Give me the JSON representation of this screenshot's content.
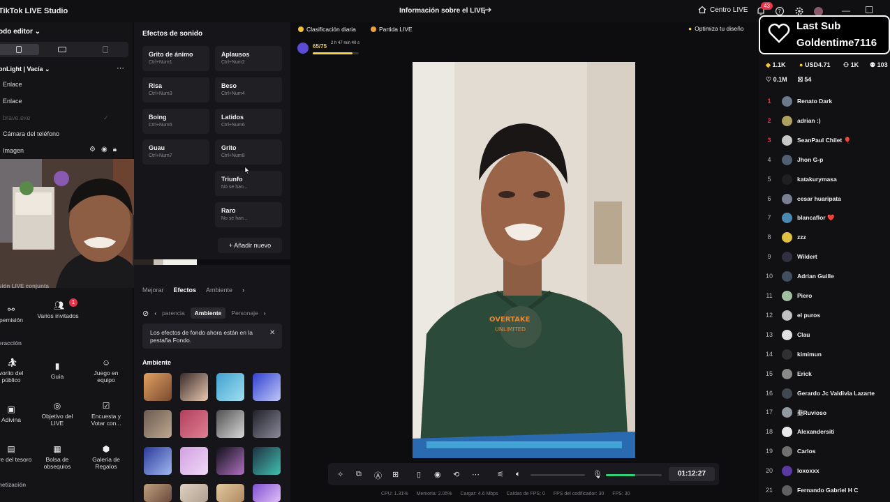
{
  "titlebar": {
    "app_title": "TikTok LIVE Studio",
    "window_title": "Información sobre el LIVE",
    "center_live": "Centro LIVE",
    "notifications": "43"
  },
  "left": {
    "mode_editor": "odo editor",
    "scene_name": "onLight | Vacía",
    "sources": [
      "Enlace",
      "Enlace",
      "brave.exe",
      "Cámara del teléfono",
      "Imagen"
    ],
    "section_partial": "sión LIVE conjunta",
    "tools_row1": [
      "pemisión",
      "Varios invitados"
    ],
    "badge": "1",
    "section_interaction": "eracción",
    "tools_row2": [
      "vorito del público",
      "Guía",
      "Juego en equipo"
    ],
    "tools_row3": [
      "Adivina",
      "Objetivo del LIVE",
      "Encuesta y Votar con..."
    ],
    "tools_row4": [
      "cofre del tesoro",
      "Bolsa de obsequios",
      "Galería de Regalos"
    ],
    "section_monetization": "netización"
  },
  "sound_effects": {
    "title": "Efectos de sonido",
    "items": [
      {
        "name": "Grito de ánimo",
        "key": "Ctrl+Num1"
      },
      {
        "name": "Aplausos",
        "key": "Ctrl+Num2"
      },
      {
        "name": "Risa",
        "key": "Ctrl+Num3"
      },
      {
        "name": "Beso",
        "key": "Ctrl+Num4"
      },
      {
        "name": "Boing",
        "key": "Ctrl+Num5"
      },
      {
        "name": "Latidos",
        "key": "Ctrl+Num6"
      },
      {
        "name": "Guau",
        "key": "Ctrl+Num7"
      },
      {
        "name": "Grito",
        "key": "Ctrl+Num8"
      },
      {
        "name": "Triunfo",
        "key": "No se han..."
      },
      {
        "name": "Raro",
        "key": "No se han..."
      }
    ],
    "add_new": "+ Añadir nuevo"
  },
  "effects": {
    "tabs": [
      "Mejorar",
      "Efectos",
      "Ambiente"
    ],
    "subtabs": [
      "parencia",
      "Ambiente",
      "Personaje"
    ],
    "notice": "Los efectos de fondo ahora están en la pestaña Fondo.",
    "section": "Ambiente"
  },
  "top": {
    "daily_rank": "Clasificación diaria",
    "match": "Partida LIVE",
    "level": "65/75",
    "level_time": "2 h 47 min 40 s",
    "level_progress": 0.87,
    "optimize": "Optimiza tu diseño"
  },
  "toolbar": {
    "timer": "01:12:27",
    "mic_level": 0.52
  },
  "status": {
    "cpu": "CPU: 1.31%",
    "memory": "Memoria: 2.05%",
    "upload": "Cargar: 4.6 Mbps",
    "fps_drops": "Caídas de FPS: 0",
    "encoder_fps": "FPS del codificador: 30",
    "fps": "FPS: 30"
  },
  "right": {
    "last_sub_title": "Last Sub",
    "last_sub_name": "Goldentime7116",
    "stats": {
      "diamonds": "1.1K",
      "usd": "USD4.71",
      "viewers": "1K",
      "other": "103",
      "likes": "0.1M",
      "gifts": "54"
    },
    "ranking": [
      {
        "n": "1",
        "name": "Renato Dark",
        "color": "#6a7a8a"
      },
      {
        "n": "2",
        "name": "adrian :)",
        "color": "#b0a060"
      },
      {
        "n": "3",
        "name": "SeanPaul Chilet 🎈",
        "color": "#c8c8c8"
      },
      {
        "n": "4",
        "name": "Jhon G-p",
        "color": "#506070"
      },
      {
        "n": "5",
        "name": "katakurymasa",
        "color": "#202020"
      },
      {
        "n": "6",
        "name": "cesar huaripata",
        "color": "#7a8090"
      },
      {
        "n": "7",
        "name": "blancaflor ❤️",
        "color": "#4a8ab0"
      },
      {
        "n": "8",
        "name": "zzz",
        "color": "#e0c040"
      },
      {
        "n": "9",
        "name": "Wildert",
        "color": "#303040"
      },
      {
        "n": "10",
        "name": "Adrian Guille",
        "color": "#405060"
      },
      {
        "n": "11",
        "name": "Piero",
        "color": "#a0c0a0"
      },
      {
        "n": "12",
        "name": "el puros",
        "color": "#c0c0c0"
      },
      {
        "n": "13",
        "name": "Clau",
        "color": "#e0e0e0"
      },
      {
        "n": "14",
        "name": "kimimun",
        "color": "#303030"
      },
      {
        "n": "15",
        "name": "Erick",
        "color": "#8a8a8a"
      },
      {
        "n": "16",
        "name": "Gerardo Jc Valdivia Lazarte",
        "color": "#404850"
      },
      {
        "n": "17",
        "name": "韭Ruvioso",
        "color": "#909aa0"
      },
      {
        "n": "18",
        "name": "Alexandersiti",
        "color": "#e8e8e8"
      },
      {
        "n": "19",
        "name": "Carlos",
        "color": "#707070"
      },
      {
        "n": "20",
        "name": "loxoxxx",
        "color": "#5a3aa0"
      },
      {
        "n": "21",
        "name": "Fernando Gabriel H C",
        "color": "#606060"
      }
    ]
  }
}
